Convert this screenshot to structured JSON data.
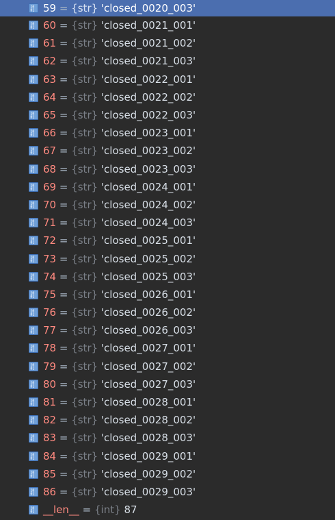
{
  "rows": [
    {
      "index": "59",
      "eq": " = ",
      "type": "{str}",
      "value": " 'closed_0020_003'",
      "selected": true
    },
    {
      "index": "60",
      "eq": " = ",
      "type": "{str}",
      "value": " 'closed_0021_001'"
    },
    {
      "index": "61",
      "eq": " = ",
      "type": "{str}",
      "value": " 'closed_0021_002'"
    },
    {
      "index": "62",
      "eq": " = ",
      "type": "{str}",
      "value": " 'closed_0021_003'"
    },
    {
      "index": "63",
      "eq": " = ",
      "type": "{str}",
      "value": " 'closed_0022_001'"
    },
    {
      "index": "64",
      "eq": " = ",
      "type": "{str}",
      "value": " 'closed_0022_002'"
    },
    {
      "index": "65",
      "eq": " = ",
      "type": "{str}",
      "value": " 'closed_0022_003'"
    },
    {
      "index": "66",
      "eq": " = ",
      "type": "{str}",
      "value": " 'closed_0023_001'"
    },
    {
      "index": "67",
      "eq": " = ",
      "type": "{str}",
      "value": " 'closed_0023_002'"
    },
    {
      "index": "68",
      "eq": " = ",
      "type": "{str}",
      "value": " 'closed_0023_003'"
    },
    {
      "index": "69",
      "eq": " = ",
      "type": "{str}",
      "value": " 'closed_0024_001'"
    },
    {
      "index": "70",
      "eq": " = ",
      "type": "{str}",
      "value": " 'closed_0024_002'"
    },
    {
      "index": "71",
      "eq": " = ",
      "type": "{str}",
      "value": " 'closed_0024_003'"
    },
    {
      "index": "72",
      "eq": " = ",
      "type": "{str}",
      "value": " 'closed_0025_001'"
    },
    {
      "index": "73",
      "eq": " = ",
      "type": "{str}",
      "value": " 'closed_0025_002'"
    },
    {
      "index": "74",
      "eq": " = ",
      "type": "{str}",
      "value": " 'closed_0025_003'"
    },
    {
      "index": "75",
      "eq": " = ",
      "type": "{str}",
      "value": " 'closed_0026_001'"
    },
    {
      "index": "76",
      "eq": " = ",
      "type": "{str}",
      "value": " 'closed_0026_002'"
    },
    {
      "index": "77",
      "eq": " = ",
      "type": "{str}",
      "value": " 'closed_0026_003'"
    },
    {
      "index": "78",
      "eq": " = ",
      "type": "{str}",
      "value": " 'closed_0027_001'"
    },
    {
      "index": "79",
      "eq": " = ",
      "type": "{str}",
      "value": " 'closed_0027_002'"
    },
    {
      "index": "80",
      "eq": " = ",
      "type": "{str}",
      "value": " 'closed_0027_003'"
    },
    {
      "index": "81",
      "eq": " = ",
      "type": "{str}",
      "value": " 'closed_0028_001'"
    },
    {
      "index": "82",
      "eq": " = ",
      "type": "{str}",
      "value": " 'closed_0028_002'"
    },
    {
      "index": "83",
      "eq": " = ",
      "type": "{str}",
      "value": " 'closed_0028_003'"
    },
    {
      "index": "84",
      "eq": " = ",
      "type": "{str}",
      "value": " 'closed_0029_001'"
    },
    {
      "index": "85",
      "eq": " = ",
      "type": "{str}",
      "value": " 'closed_0029_002'"
    },
    {
      "index": "86",
      "eq": " = ",
      "type": "{str}",
      "value": " 'closed_0029_003'"
    }
  ],
  "len_row": {
    "name": "__len__",
    "eq": " = ",
    "type": "{int}",
    "value": " 87"
  },
  "icon": "binary-variable-icon",
  "colors": {
    "background": "#2b2b2b",
    "selection": "#4b6eaf",
    "index": "#ff8a80",
    "type": "#7a7f87",
    "value": "#d7dee6"
  }
}
